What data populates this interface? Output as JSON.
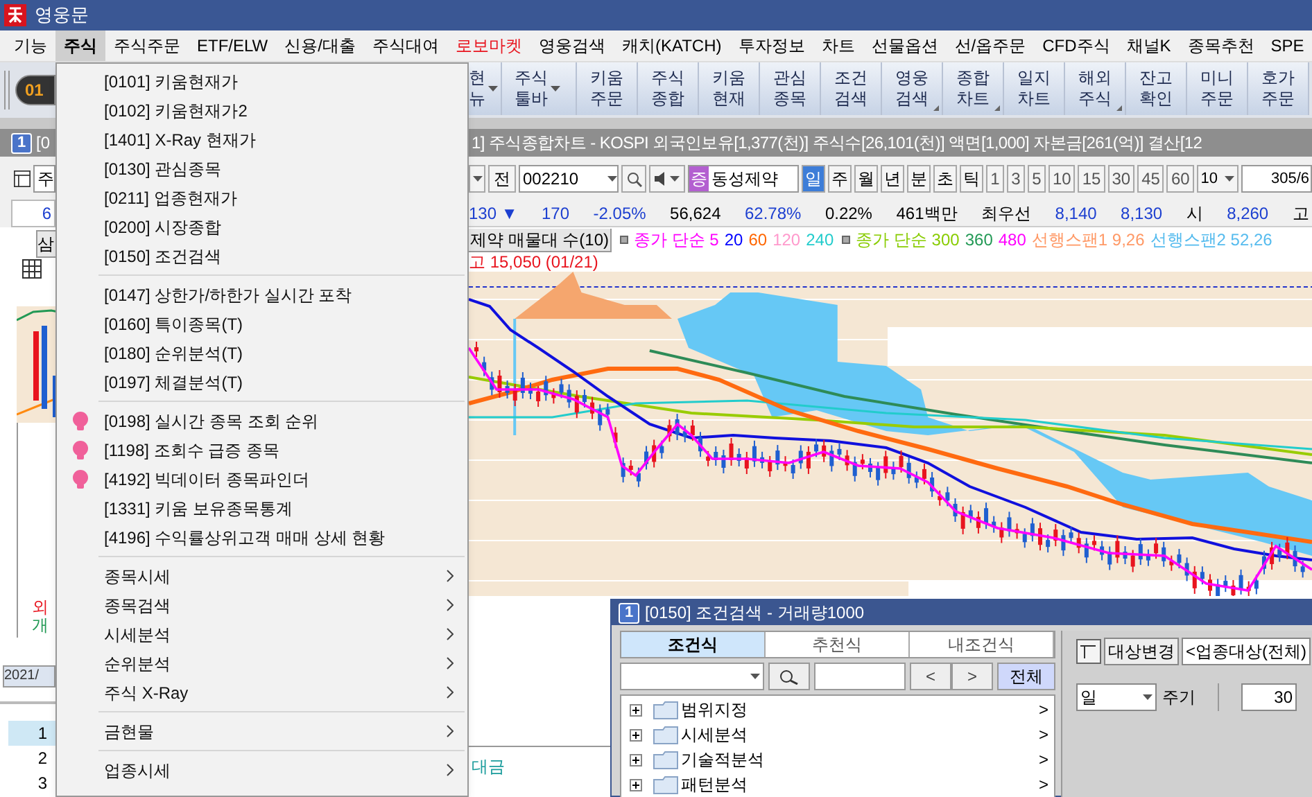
{
  "window": {
    "title": "영웅문"
  },
  "menu_bar": [
    {
      "label": "기능",
      "selected": false,
      "color": "#000000"
    },
    {
      "label": "주식",
      "selected": true,
      "color": "#000000"
    },
    {
      "label": "주식주문",
      "selected": false,
      "color": "#000000"
    },
    {
      "label": "ETF/ELW",
      "selected": false,
      "color": "#000000"
    },
    {
      "label": "신용/대출",
      "selected": false,
      "color": "#000000"
    },
    {
      "label": "주식대여",
      "selected": false,
      "color": "#000000"
    },
    {
      "label": "로보마켓",
      "selected": false,
      "color": "#e8141e"
    },
    {
      "label": "영웅검색",
      "selected": false,
      "color": "#000000"
    },
    {
      "label": "캐치(KATCH)",
      "selected": false,
      "color": "#000000"
    },
    {
      "label": "투자정보",
      "selected": false,
      "color": "#000000"
    },
    {
      "label": "차트",
      "selected": false,
      "color": "#000000"
    },
    {
      "label": "선물옵션",
      "selected": false,
      "color": "#000000"
    },
    {
      "label": "선/옵주문",
      "selected": false,
      "color": "#000000"
    },
    {
      "label": "CFD주식",
      "selected": false,
      "color": "#000000"
    },
    {
      "label": "채널K",
      "selected": false,
      "color": "#000000"
    },
    {
      "label": "종목추천",
      "selected": false,
      "color": "#000000"
    },
    {
      "label": "SPE",
      "selected": false,
      "color": "#000000"
    }
  ],
  "menu": [
    {
      "kind": "item",
      "label": "[0101] 키움현재가",
      "hot": false
    },
    {
      "kind": "item",
      "label": "[0102] 키움현재가2",
      "hot": false
    },
    {
      "kind": "item",
      "label": "[1401] X-Ray 현재가",
      "hot": false
    },
    {
      "kind": "item",
      "label": "[0130] 관심종목",
      "hot": false
    },
    {
      "kind": "item",
      "label": "[0211] 업종현재가",
      "hot": false
    },
    {
      "kind": "item",
      "label": "[0200] 시장종합",
      "hot": false
    },
    {
      "kind": "item",
      "label": "[0150] 조건검색",
      "hot": false
    },
    {
      "kind": "separator"
    },
    {
      "kind": "item",
      "label": "[0147] 상한가/하한가 실시간 포착",
      "hot": false
    },
    {
      "kind": "item",
      "label": "[0160] 특이종목(T)",
      "hot": false
    },
    {
      "kind": "item",
      "label": "[0180] 순위분석(T)",
      "hot": false
    },
    {
      "kind": "item",
      "label": "[0197] 체결분석(T)",
      "hot": false
    },
    {
      "kind": "separator"
    },
    {
      "kind": "item",
      "label": "[0198] 실시간 종목 조회 순위",
      "hot": true
    },
    {
      "kind": "item",
      "label": "[1198] 조회수 급증 종목",
      "hot": true
    },
    {
      "kind": "item",
      "label": "[4192] 빅데이터 종목파인더",
      "hot": true
    },
    {
      "kind": "item",
      "label": "[1331] 키움 보유종목통계",
      "hot": false
    },
    {
      "kind": "item",
      "label": "[4196] 수익률상위고객 매매 상세 현황",
      "hot": false
    },
    {
      "kind": "separator"
    },
    {
      "kind": "submenu",
      "label": "종목시세"
    },
    {
      "kind": "submenu",
      "label": "종목검색"
    },
    {
      "kind": "submenu",
      "label": "시세분석"
    },
    {
      "kind": "submenu",
      "label": "순위분석"
    },
    {
      "kind": "submenu",
      "label": "주식 X-Ray"
    },
    {
      "kind": "separator"
    },
    {
      "kind": "submenu",
      "label": "금현물"
    },
    {
      "kind": "separator"
    },
    {
      "kind": "submenu",
      "label": "업종시세"
    }
  ],
  "toolbar": {
    "badge": "01",
    "buttons": [
      {
        "lines": [
          "현",
          "뉴"
        ],
        "kind": "menu"
      },
      {
        "lines": [
          "주식",
          "툴바"
        ],
        "kind": "menu"
      },
      {
        "lines": [
          "키움",
          "주문"
        ],
        "kind": "plain"
      },
      {
        "lines": [
          "주식",
          "종합"
        ],
        "kind": "plain"
      },
      {
        "lines": [
          "키움",
          "현재"
        ],
        "kind": "plain"
      },
      {
        "lines": [
          "관심",
          "종목"
        ],
        "kind": "plain"
      },
      {
        "lines": [
          "조건",
          "검색"
        ],
        "kind": "plain"
      },
      {
        "lines": [
          "영웅",
          "검색"
        ],
        "kind": "corner"
      },
      {
        "lines": [
          "종합",
          "차트"
        ],
        "kind": "corner"
      },
      {
        "lines": [
          "일지",
          "차트"
        ],
        "kind": "plain"
      },
      {
        "lines": [
          "해외",
          "주식"
        ],
        "kind": "corner"
      },
      {
        "lines": [
          "잔고",
          "확인"
        ],
        "kind": "plain"
      },
      {
        "lines": [
          "미니",
          "주문"
        ],
        "kind": "plain"
      },
      {
        "lines": [
          "호가",
          "주문"
        ],
        "kind": "plain"
      }
    ]
  },
  "left_window": {
    "badge": "1",
    "title": "[0",
    "code_field": "주",
    "price": "6",
    "stock_tag": "삼",
    "legend": [
      {
        "text": "외",
        "color": "#e8141e"
      },
      {
        "text": "개",
        "color": "#229955"
      }
    ],
    "date": "2021/",
    "rows": [
      {
        "number": "1",
        "selected": true
      },
      {
        "number": "2",
        "selected": false
      },
      {
        "number": "3",
        "selected": false
      }
    ]
  },
  "chart_window": {
    "title": "1] 주식종합차트 - KOSPI 외국인보유[1,377(천)] 주식수[26,101(천)] 액면[1,000] 자본금[261(억)] 결산[12",
    "prefix": "전",
    "code": "002210",
    "market_tag": "증",
    "stock_name": "동성제약",
    "periods": [
      {
        "label": "일",
        "selected": true
      },
      {
        "label": "주",
        "selected": false
      },
      {
        "label": "월",
        "selected": false
      },
      {
        "label": "년",
        "selected": false
      }
    ],
    "units": [
      {
        "label": "분",
        "selected": false
      },
      {
        "label": "초",
        "selected": false
      },
      {
        "label": "틱",
        "selected": false
      }
    ],
    "intervals": [
      "1",
      "3",
      "5",
      "10",
      "15",
      "30",
      "45",
      "60"
    ],
    "count": "10",
    "page": "305/6",
    "info": [
      {
        "text": "130 ▼",
        "color": "#1c3fd0"
      },
      {
        "text": "170",
        "color": "#1c3fd0"
      },
      {
        "text": "-2.05%",
        "color": "#1c3fd0"
      },
      {
        "text": "56,624",
        "color": "#000000"
      },
      {
        "text": "62.78%",
        "color": "#1c3fd0"
      },
      {
        "text": "0.22%",
        "color": "#000000"
      },
      {
        "text": "461백만",
        "color": "#000000"
      },
      {
        "text": "최우선",
        "color": "#000000"
      },
      {
        "text": "8,140",
        "color": "#1c3fd0"
      },
      {
        "text": "8,130",
        "color": "#1c3fd0"
      },
      {
        "text": "시",
        "color": "#000000"
      },
      {
        "text": "8,260",
        "color": "#1c3fd0"
      },
      {
        "text": "고",
        "color": "#000000"
      }
    ],
    "indicator": "제약 매물대 수(10)",
    "legend": [
      {
        "parts": [
          {
            "text": "종가 단순 5",
            "color": "#ff00ff"
          },
          {
            "text": "20",
            "color": "#0000ff"
          },
          {
            "text": "60",
            "color": "#ff6600"
          },
          {
            "text": "120",
            "color": "#ff99cc"
          },
          {
            "text": "240",
            "color": "#22cccc"
          }
        ]
      },
      {
        "parts": [
          {
            "text": "종가 단순 300",
            "color": "#88cc00"
          },
          {
            "text": "360",
            "color": "#229955"
          },
          {
            "text": "480",
            "color": "#ff00ff"
          },
          {
            "text": "선행스팬1 9,26",
            "color": "#ff9966"
          },
          {
            "text": "선행스팬2 52,26",
            "color": "#55bbee"
          }
        ]
      }
    ],
    "high_label": "고 15,050 (01/21)",
    "volume_label": "대금"
  },
  "search_window": {
    "badge": "1",
    "title": "[0150] 조건검색 - 거래량1000",
    "tabs": [
      {
        "label": "조건식",
        "selected": true
      },
      {
        "label": "추천식",
        "selected": false
      },
      {
        "label": "내조건식",
        "selected": false
      }
    ],
    "prev": "<",
    "next": ">",
    "all": "전체",
    "tree": [
      {
        "label": "범위지정",
        "arrow": ">"
      },
      {
        "label": "시세분석",
        "arrow": ">"
      },
      {
        "label": "기술적분석",
        "arrow": ">"
      },
      {
        "label": "패턴분석",
        "arrow": ">"
      }
    ],
    "target_button": "대상변경",
    "target": "<업종대상(전체)",
    "period": "일",
    "period_label": "주기",
    "spin": "30"
  }
}
